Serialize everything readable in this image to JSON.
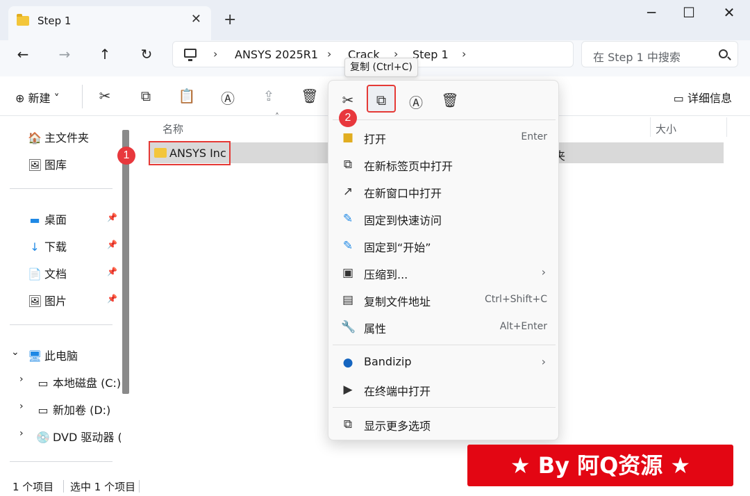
{
  "window": {
    "tab_title": "Step 1",
    "close_glyph": "✕",
    "new_tab_glyph": "+",
    "minimize_glyph": "─",
    "maximize_glyph": "☐",
    "window_close_glyph": "✕"
  },
  "nav": {
    "back_glyph": "←",
    "forward_glyph": "→",
    "up_glyph": "↑",
    "refresh_glyph": "↻",
    "breadcrumb": [
      "ANSYS 2025R1",
      "Crack",
      "Step 1"
    ],
    "sep": "›",
    "search_placeholder": "在 Step 1 中搜索"
  },
  "toolbar": {
    "new_label": "⊕  新建 ˅",
    "details_label": "详细信息"
  },
  "sidebar": {
    "home": "主文件夹",
    "gallery": "图库",
    "desktop": "桌面",
    "downloads": "下载",
    "documents": "文档",
    "pictures": "图片",
    "this_pc": "此电脑",
    "drive_c": "本地磁盘 (C:)",
    "drive_d": "新加卷 (D:)",
    "drive_e": "DVD 驱动器 (E"
  },
  "files": {
    "col_name": "名称",
    "col_size": "大小",
    "row_name": "ANSYS Inc",
    "row_type_fragment": "夹"
  },
  "status": {
    "count": "1 个项目",
    "selected": "选中 1 个项目"
  },
  "tooltip": "复制 (Ctrl+C)",
  "badges": [
    "1",
    "2"
  ],
  "context_menu": {
    "items": [
      {
        "label": "打开",
        "shortcut": "Enter",
        "icon": "folder-icon"
      },
      {
        "label": "在新标签页中打开",
        "shortcut": "",
        "icon": "new-tab-icon"
      },
      {
        "label": "在新窗口中打开",
        "shortcut": "",
        "icon": "new-window-icon"
      },
      {
        "label": "固定到快速访问",
        "shortcut": "",
        "icon": "pin-icon"
      },
      {
        "label": "固定到“开始”",
        "shortcut": "",
        "icon": "pin-icon"
      },
      {
        "label": "压缩到...",
        "shortcut": "",
        "icon": "archive-icon"
      },
      {
        "label": "复制文件地址",
        "shortcut": "Ctrl+Shift+C",
        "icon": "copy-path-icon"
      },
      {
        "label": "属性",
        "shortcut": "Alt+Enter",
        "icon": "wrench-icon"
      },
      {
        "label": "Bandizip",
        "shortcut": "",
        "icon": "bandizip-icon"
      },
      {
        "label": "在终端中打开",
        "shortcut": "",
        "icon": "terminal-icon"
      },
      {
        "label": "显示更多选项",
        "shortcut": "",
        "icon": "more-options-icon"
      }
    ]
  },
  "banner": "★ By 阿Q资源 ★",
  "colors": {
    "accent_red": "#e30613",
    "highlight_border": "#e53935",
    "selection": "#d9d9d9"
  }
}
